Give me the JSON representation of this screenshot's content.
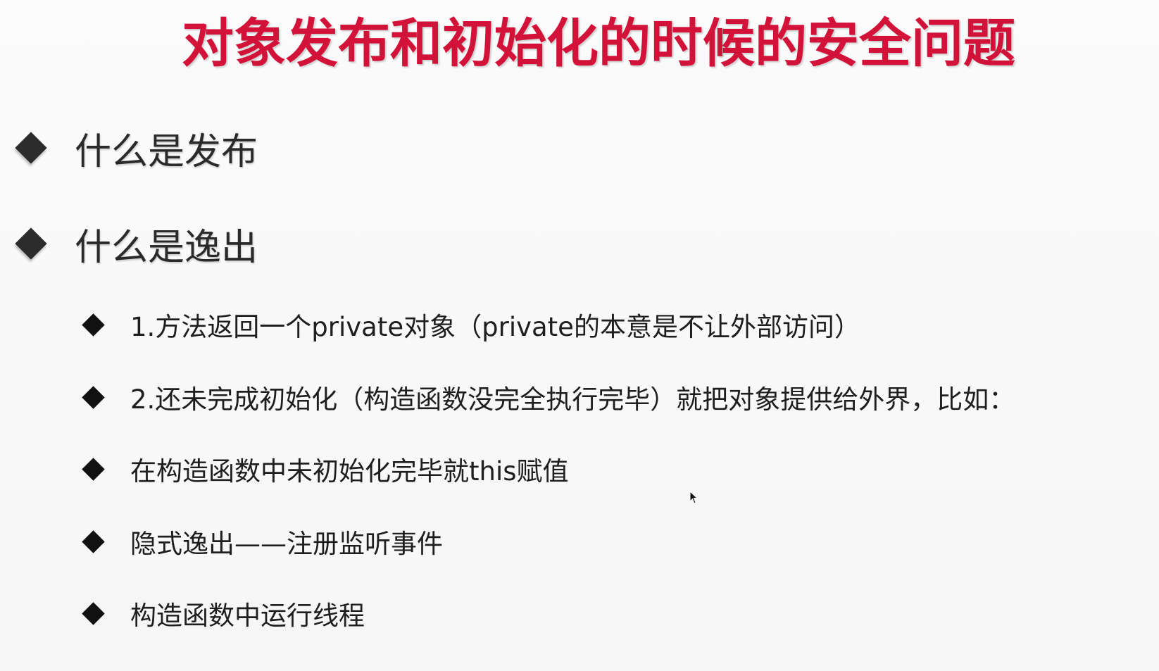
{
  "slide": {
    "title": "对象发布和初始化的时候的安全问题",
    "main_points": [
      {
        "text": "什么是发布"
      },
      {
        "text": "什么是逸出"
      }
    ],
    "sub_points": [
      {
        "text": "1.方法返回一个private对象（private的本意是不让外部访问）"
      },
      {
        "text": "2.还未完成初始化（构造函数没完全执行完毕）就把对象提供给外界，比如："
      },
      {
        "text": "在构造函数中未初始化完毕就this赋值"
      },
      {
        "text": "隐式逸出——注册监听事件"
      },
      {
        "text": "构造函数中运行线程"
      }
    ]
  },
  "colors": {
    "title": "#d3123a",
    "text": "#1e1e1e",
    "background": "#fafafa"
  },
  "icons": {
    "bullet": "diamond-bullet-icon",
    "cursor": "mouse-pointer-icon"
  }
}
